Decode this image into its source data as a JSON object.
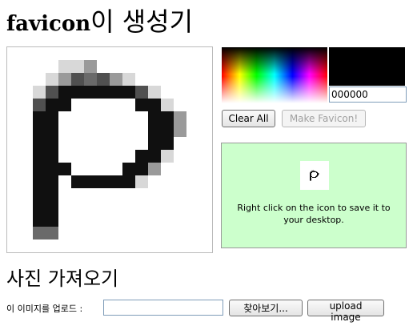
{
  "title": {
    "latin": "favicon",
    "hangul": "이 생성기"
  },
  "color_picker": {
    "selected_color": "#000000",
    "hex_value": "000000"
  },
  "buttons": {
    "clear_all": "Clear All",
    "make_favicon": "Make Favicon!"
  },
  "result": {
    "message": "Right click on the icon to save it to your desktop."
  },
  "import": {
    "heading": "사진 가져오기",
    "upload_label": "이 이미지를 업로드 :",
    "file_value": "",
    "browse": "찾아보기...",
    "upload_button": "upload image"
  },
  "canvas": {
    "grid_size": 16,
    "glyph": "p",
    "pixel_rows": [
      "................",
      "....aab.........",
      "...abcdcba......",
      "..aceeeeeeca....",
      "..cee.....eea...",
      "..ee.......eeb..",
      "..ee.......eeb..",
      "..ee.......ee...",
      "..ee......eea...",
      "..eee....eeb....",
      "..ee.eeeeea.....",
      "..ee............",
      "..ee............",
      "..ee............",
      "..dd............",
      "................"
    ],
    "pixel_colors": {
      "a": "#d8d8d8",
      "b": "#9a9a9a",
      "c": "#505050",
      "d": "#6a6a6a",
      "e": "#101010"
    }
  }
}
